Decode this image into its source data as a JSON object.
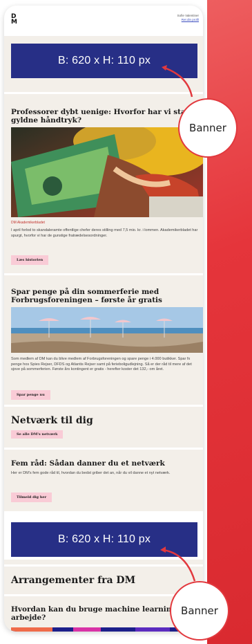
{
  "header": {
    "logo": "DM",
    "user_name": "Sofie Valentiner",
    "logout_label": "Ret din profil"
  },
  "banners": [
    {
      "label": "B: 620 x H: 110 px"
    },
    {
      "label": "B: 620 x H: 110 px"
    }
  ],
  "callouts": [
    {
      "label": "Banner"
    },
    {
      "label": "Banner"
    }
  ],
  "articles": [
    {
      "title": "Professorer dybt uenige: Hvorfor har vi staaet om gyldne håndtryk?",
      "title_visible": "Professorer dybt uenige: Hvorfor har vi sta",
      "title_line2": "gyldne håndtryk?",
      "source": "DM Akademikerbladet",
      "body": "I april forlod to skandaleramte offentlige chefer deres stilling med 7,5 mio. kr. i lommen. Akademikerbladet har spurgt, hvorfor vi har de gunstige fratrædelsesordninger.",
      "button": "Læs historien"
    },
    {
      "title_line1": "Spar penge på din sommerferie med",
      "title_line2": "Forbrugsforeningen – første år gratis",
      "body": "Som medlem af DM kan du blive medlem af Forbrugsforeningen og spare penge i 4.000 butikker. Spar fx penge hos Spies Rejser, DFDS og Atlantis Rejser samt på feriebolig­udlejning. Så er der råd til mere af det sjove på sommerferien. Første års kontingent er gratis - herefter koster det 132,- om året.",
      "button": "Spar penge nu"
    }
  ],
  "network": {
    "title": "Netværk til dig",
    "button": "Se alle DM's netværk"
  },
  "tips": {
    "title": "Fem råd: Sådan danner du et netværk",
    "body": "Her er DM's fem gode råd til, hvordan du bedst griber det an, når du vil danne et nyt netværk.",
    "button": "Tilmeld dig her"
  },
  "events": {
    "title": "Arrangementer fra DM",
    "item_title_line1": "Hvordan kan du bruge machine learning",
    "item_title_line2": "arbejde?"
  },
  "colors": {
    "accent": "#e5353b",
    "banner": "#272f86",
    "button": "#f9cbd6",
    "card": "#f3efe9"
  }
}
